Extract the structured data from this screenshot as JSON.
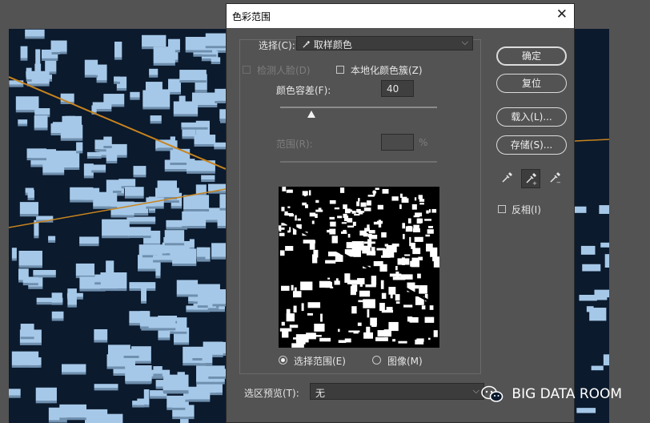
{
  "dialog": {
    "title": "色彩范围",
    "close_glyph": "✕",
    "select_label": "选择(C):",
    "select_value": "取样颜色",
    "select_icon": "eyedropper-icon",
    "detect_faces_label": "检测人脸(D)",
    "detect_faces_checked": false,
    "localized_clusters_label": "本地化颜色簇(Z)",
    "localized_clusters_checked": false,
    "fuzziness_label": "颜色容差(F):",
    "fuzziness_value": "40",
    "fuzziness_level": 0.2,
    "range_label": "范围(R):",
    "range_value": "",
    "range_unit": "%",
    "radio_selection_label": "选择范围(E)",
    "radio_image_label": "图像(M)",
    "radio_selected": "selection",
    "preview_label": "选区预览(T):",
    "preview_value": "无"
  },
  "buttons": {
    "ok": "确定",
    "reset": "复位",
    "load": "载入(L)...",
    "save": "存储(S)..."
  },
  "tools": {
    "eyedropper": "eyedropper-icon",
    "add_eyedropper": "eyedropper-plus-icon",
    "subtract_eyedropper": "eyedropper-minus-icon",
    "active_tool": "add_eyedropper",
    "plus_glyph": "+",
    "minus_glyph": "−"
  },
  "invert": {
    "label": "反相(I)",
    "checked": false
  },
  "watermark": {
    "text": "BIG DATA ROOM",
    "icon": "wechat-icon"
  },
  "colors": {
    "dialog_bg": "#535353",
    "title_bg": "#ffffff",
    "city_bg": "#0b1a2d",
    "building": "#a6c8e8",
    "road": "#c8841e"
  }
}
